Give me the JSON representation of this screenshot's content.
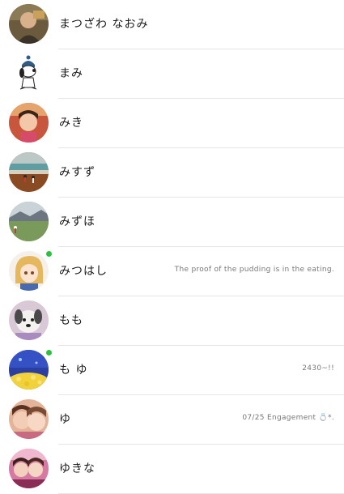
{
  "contacts": [
    {
      "name": "まつざわ なおみ",
      "status": "",
      "online": false
    },
    {
      "name": "まみ",
      "status": "",
      "online": false
    },
    {
      "name": "みき",
      "status": "",
      "online": false
    },
    {
      "name": "みすず",
      "status": "",
      "online": false
    },
    {
      "name": "みずほ",
      "status": "",
      "online": false
    },
    {
      "name": "みつはし",
      "status": "The proof of the pudding is in the eating.",
      "online": true
    },
    {
      "name": "もも",
      "status": "",
      "online": false
    },
    {
      "name": "も ゆ",
      "status": "2430~!!",
      "online": true
    },
    {
      "name": "ゆ",
      "status": "07/25 Engagement 💍*.",
      "online": false
    },
    {
      "name": "ゆきな",
      "status": "",
      "online": false
    }
  ],
  "colors": {
    "online": "#2bc33b",
    "divider": "#e6e6e6"
  }
}
